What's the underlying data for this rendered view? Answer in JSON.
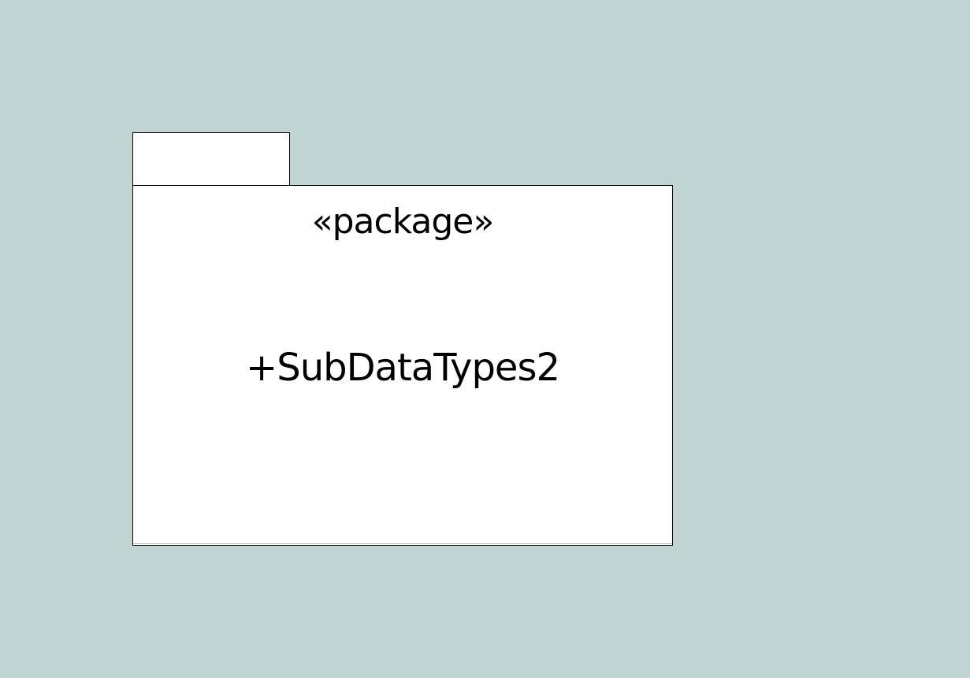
{
  "diagram": {
    "package": {
      "stereotype": "«package»",
      "name": "+SubDataTypes2"
    }
  },
  "colors": {
    "canvas_background": "#bfd4d3",
    "package_fill": "#ffffff",
    "package_border": "#000000",
    "text": "#000000"
  }
}
